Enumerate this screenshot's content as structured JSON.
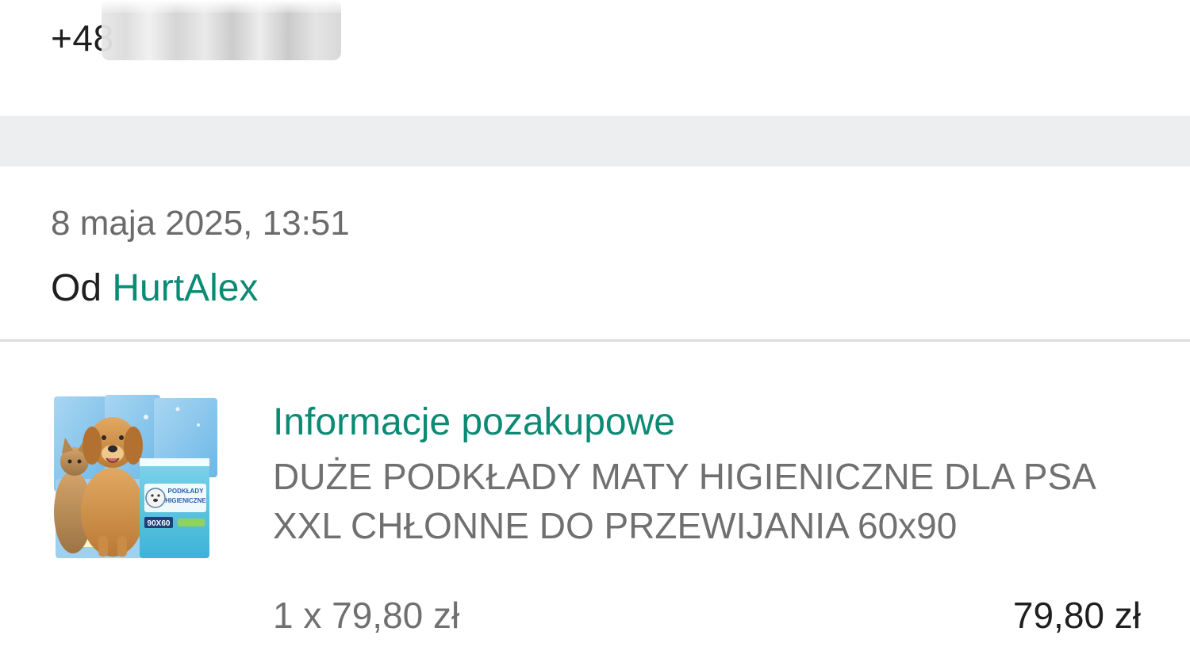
{
  "contact": {
    "phone_prefix": "+48"
  },
  "message": {
    "date": "8 maja 2025, 13:51",
    "from_label": "Od",
    "sender": "HurtAlex"
  },
  "order_item": {
    "section_title": "Informacje pozakupowe",
    "product_name": "DUŻE PODKŁADY MATY HIGIENICZNE DLA PSA XXL CHŁONNE DO PRZEWIJANIA 60x90",
    "quantity_price": "1 x 79,80 zł",
    "total": "79,80 zł",
    "image": {
      "package_line1": "PODKŁADY",
      "package_line2": "HIGIENICZNE",
      "package_size": "90X60"
    }
  },
  "colors": {
    "accent": "#0b8a74",
    "text_primary": "#1f1f1f",
    "text_secondary": "#707070",
    "band": "#eceef0"
  }
}
